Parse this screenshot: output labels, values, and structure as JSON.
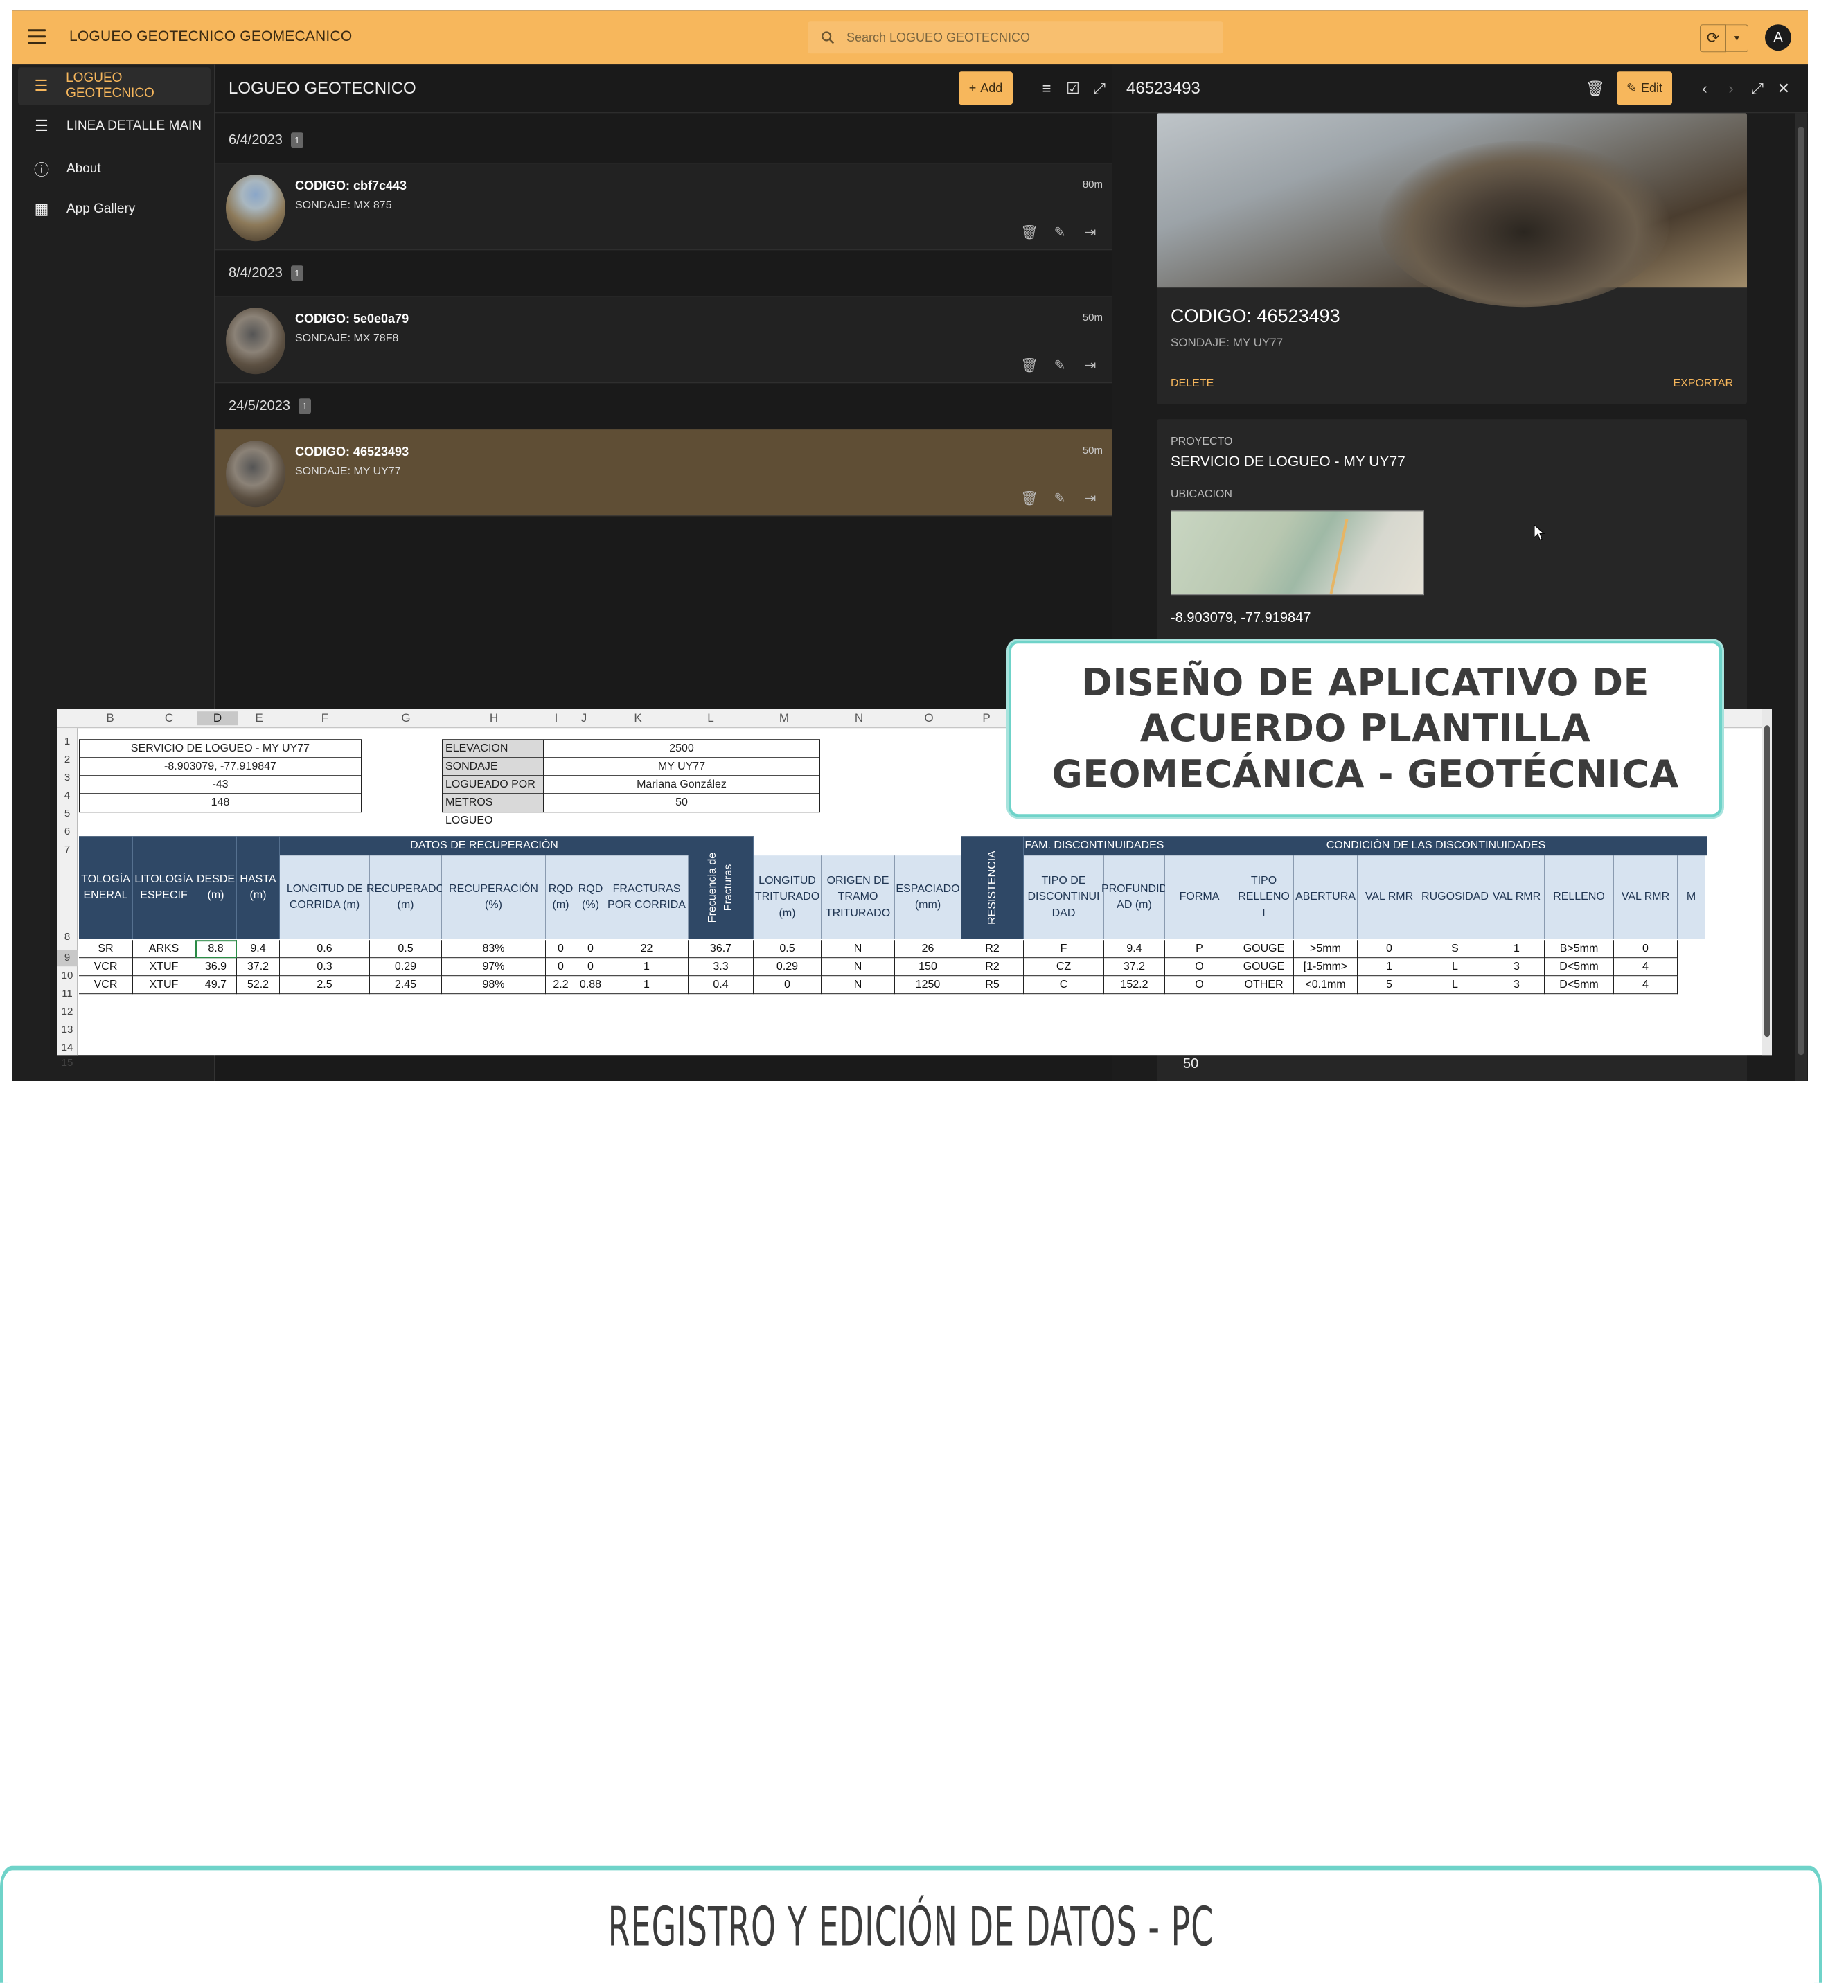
{
  "app": {
    "title": "LOGUEO GEOTECNICO GEOMECANICO",
    "search_placeholder": "Search LOGUEO GEOTECNICO",
    "avatar_initial": "A"
  },
  "sidebar": {
    "items": [
      {
        "label": "LOGUEO GEOTECNICO",
        "icon": "list-icon",
        "active": true
      },
      {
        "label": "LINEA DETALLE MAIN",
        "icon": "list-icon",
        "active": false
      },
      {
        "label": "About",
        "icon": "info-icon",
        "active": false
      },
      {
        "label": "App Gallery",
        "icon": "grid-icon",
        "active": false
      }
    ]
  },
  "list": {
    "title": "LOGUEO GEOTECNICO",
    "add_label": "Add",
    "groups": [
      {
        "date": "6/4/2023",
        "count": "1",
        "card": {
          "code": "CODIGO: cbf7c443",
          "sondaje": "SONDAJE: MX 875",
          "depth": "80m"
        }
      },
      {
        "date": "8/4/2023",
        "count": "1",
        "card": {
          "code": "CODIGO: 5e0e0a79",
          "sondaje": "SONDAJE: MX 78F8",
          "depth": "50m"
        }
      },
      {
        "date": "24/5/2023",
        "count": "1",
        "card": {
          "code": "CODIGO: 46523493",
          "sondaje": "SONDAJE: MY UY77",
          "depth": "50m"
        }
      }
    ]
  },
  "detail": {
    "title": "46523493",
    "edit_label": "Edit",
    "code": "CODIGO: 46523493",
    "sondaje": "SONDAJE: MY UY77",
    "delete_label": "DELETE",
    "export_label": "EXPORTAR",
    "proyecto_label": "PROYECTO",
    "proyecto_value": "SERVICIO DE LOGUEO - MY UY77",
    "ubicacion_label": "UBICACION",
    "coords": "-8.903079, -77.919847",
    "bottom_value": "50"
  },
  "sheet": {
    "columns": [
      "B",
      "C",
      "D",
      "E",
      "F",
      "G",
      "H",
      "I",
      "J",
      "K",
      "L",
      "M",
      "N",
      "O",
      "P"
    ],
    "selected_column": "D",
    "rows": [
      "1",
      "2",
      "3",
      "4",
      "5",
      "6",
      "7",
      "8",
      "9",
      "10",
      "11",
      "12",
      "13",
      "14",
      "15"
    ],
    "selected_row": "9",
    "summary": [
      "SERVICIO DE LOGUEO - MY UY77",
      "-8.903079, -77.919847",
      "-43",
      "148"
    ],
    "meta": [
      {
        "k": "ELEVACION",
        "v": "2500"
      },
      {
        "k": "SONDAJE",
        "v": "MY UY77"
      },
      {
        "k": "LOGUEADO POR",
        "v": "Mariana González"
      },
      {
        "k": "METROS LOGUEO",
        "v": "50"
      }
    ],
    "bands": {
      "recuperacion": "DATOS DE RECUPERACIÓN",
      "fam": "FAM. DISCONTINUIDADES",
      "condicion": "CONDICIÓN DE LAS DISCONTINUIDADES"
    },
    "headers": [
      "TOLOGÍA ENERAL",
      "LITOLOGÍA ESPECIF",
      "DESDE (m)",
      "HASTA (m)",
      "LONGITUD DE CORRIDA (m)",
      "RECUPERADO (m)",
      "RECUPERACIÓN (%)",
      "RQD (m)",
      "RQD (%)",
      "FRACTURAS POR CORRIDA",
      "Frecuencia de Fracturas",
      "LONGITUD TRITURADO (m)",
      "ORIGEN DE TRAMO TRITURADO",
      "ESPACIADO (mm)",
      "RESISTENCIA",
      "TIPO DE DISCONTINUI DAD",
      "PROFUNDID AD (m)",
      "FORMA",
      "TIPO RELLENO I",
      "ABERTURA",
      "VAL RMR",
      "RUGOSIDAD",
      "VAL RMR",
      "RELLENO",
      "VAL RMR",
      "M"
    ],
    "data": [
      [
        "SR",
        "ARKS",
        "8.8",
        "9.4",
        "0.6",
        "0.5",
        "83%",
        "0",
        "0",
        "22",
        "36.7",
        "0.5",
        "N",
        "26",
        "R2",
        "F",
        "9.4",
        "P",
        "GOUGE",
        ">5mm",
        "0",
        "S",
        "1",
        "B>5mm",
        "0"
      ],
      [
        "VCR",
        "XTUF",
        "36.9",
        "37.2",
        "0.3",
        "0.29",
        "97%",
        "0",
        "0",
        "1",
        "3.3",
        "0.29",
        "N",
        "150",
        "R2",
        "CZ",
        "37.2",
        "O",
        "GOUGE",
        "[1-5mm>",
        "1",
        "L",
        "3",
        "D<5mm",
        "4"
      ],
      [
        "VCR",
        "XTUF",
        "49.7",
        "52.2",
        "2.5",
        "2.45",
        "98%",
        "2.2",
        "0.88",
        "1",
        "0.4",
        "0",
        "N",
        "1250",
        "R5",
        "C",
        "152.2",
        "O",
        "OTHER",
        "<0.1mm",
        "5",
        "L",
        "3",
        "D<5mm",
        "4"
      ]
    ]
  },
  "overlay": {
    "line1": "DISEÑO DE APLICATIVO DE",
    "line2": "ACUERDO PLANTILLA",
    "line3": "GEOMECÁNICA - GEOTÉCNICA"
  },
  "caption": "REGISTRO Y EDICIÓN DE DATOS - PC",
  "colors": {
    "accent": "#f7b75c",
    "selected_card": "#5f4e35",
    "header_band": "#2f4866",
    "overlay_border": "#6fd3c9"
  }
}
